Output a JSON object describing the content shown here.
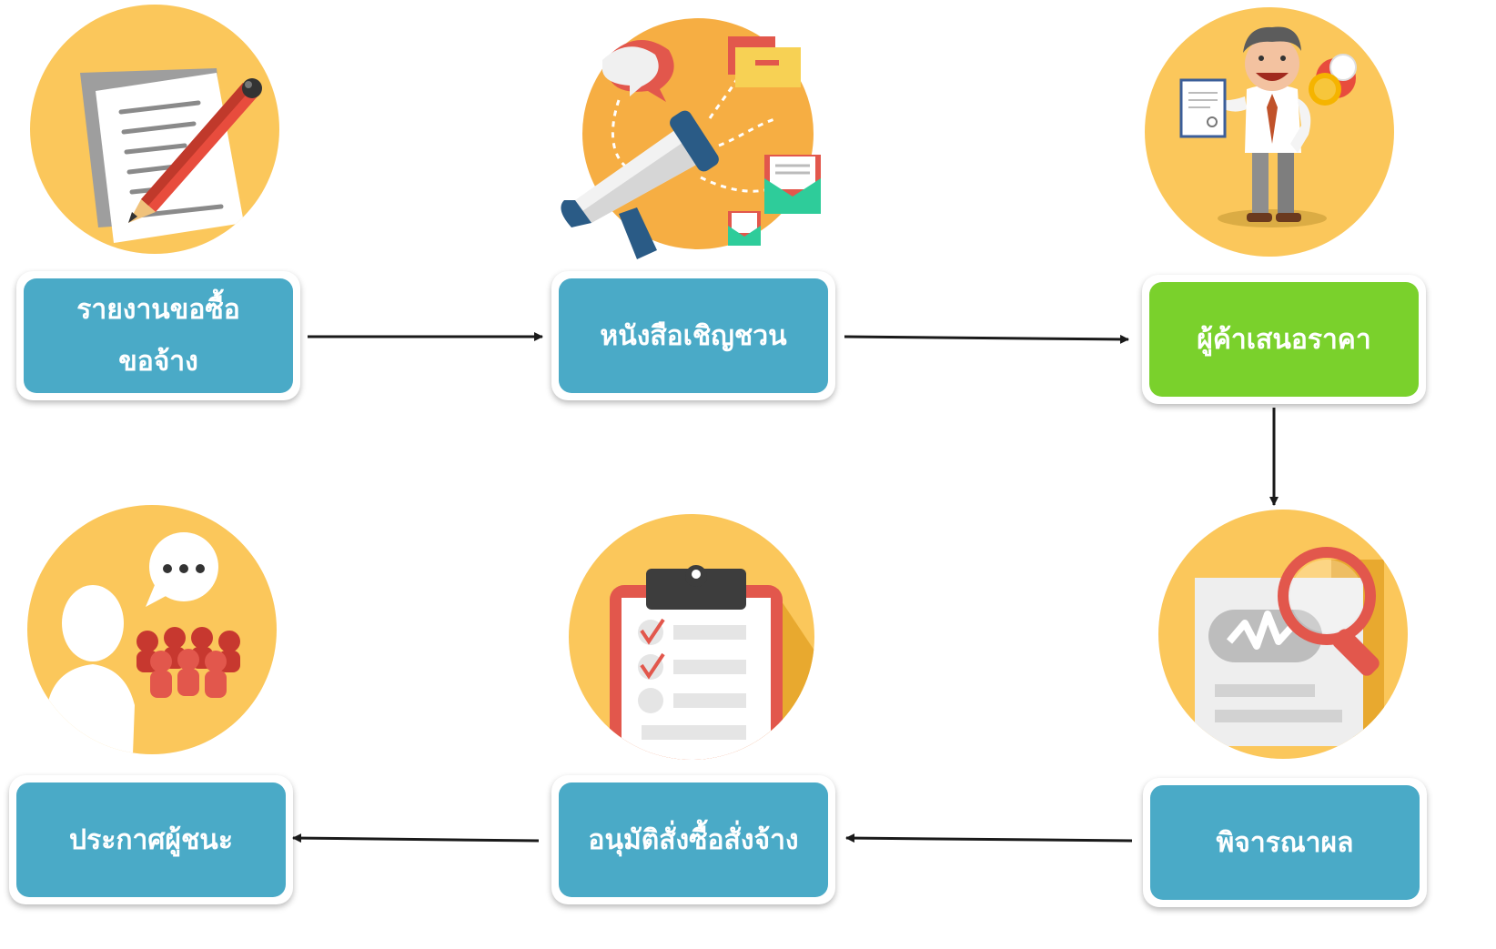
{
  "colors": {
    "circle": "#fbc75b",
    "step_box": "#4aaac7",
    "highlight_box": "#7ad12c",
    "arrow": "#1a1a1a"
  },
  "steps": [
    {
      "id": "request-report",
      "line1": "รายงานขอซื้อ",
      "line2": "ขอจ้าง",
      "icon": "document-pencil-icon",
      "highlight": false
    },
    {
      "id": "invitation-letter",
      "line1": "หนังสือเชิญชวน",
      "line2": "",
      "icon": "megaphone-icon",
      "highlight": false
    },
    {
      "id": "vendor-quote",
      "line1": "ผู้ค้าเสนอราคา",
      "line2": "",
      "icon": "businessman-icon",
      "highlight": true
    },
    {
      "id": "evaluation",
      "line1": "พิจารณาผล",
      "line2": "",
      "icon": "magnifier-document-icon",
      "highlight": false
    },
    {
      "id": "approve-order",
      "line1": "อนุมัติสั่งซื้อสั่งจ้าง",
      "line2": "",
      "icon": "clipboard-checklist-icon",
      "highlight": false
    },
    {
      "id": "announce-winner",
      "line1": "ประกาศผู้ชนะ",
      "line2": "",
      "icon": "announcement-people-icon",
      "highlight": false
    }
  ]
}
